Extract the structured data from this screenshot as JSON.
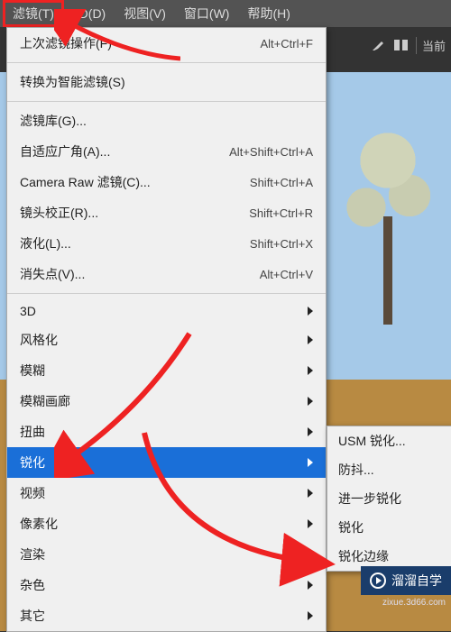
{
  "menubar": {
    "filter": "滤镜(T)",
    "threed": "3D(D)",
    "view": "视图(V)",
    "window": "窗口(W)",
    "help": "帮助(H)"
  },
  "toolbar": {
    "current": "当前"
  },
  "menu": {
    "last_filter": "上次滤镜操作(F)",
    "last_filter_sc": "Alt+Ctrl+F",
    "convert_smart": "转换为智能滤镜(S)",
    "gallery": "滤镜库(G)...",
    "adaptive": "自适应广角(A)...",
    "adaptive_sc": "Alt+Shift+Ctrl+A",
    "camera_raw": "Camera Raw 滤镜(C)...",
    "camera_raw_sc": "Shift+Ctrl+A",
    "lens": "镜头校正(R)...",
    "lens_sc": "Shift+Ctrl+R",
    "liquify": "液化(L)...",
    "liquify_sc": "Shift+Ctrl+X",
    "vanishing": "消失点(V)...",
    "vanishing_sc": "Alt+Ctrl+V",
    "threed": "3D",
    "stylize": "风格化",
    "blur": "模糊",
    "blur_gallery": "模糊画廊",
    "distort": "扭曲",
    "sharpen": "锐化",
    "video": "视频",
    "pixelate": "像素化",
    "render": "渲染",
    "noise": "杂色",
    "other": "其它"
  },
  "submenu": {
    "usm": "USM 锐化...",
    "shake": "防抖...",
    "further": "进一步锐化",
    "sharpen": "锐化",
    "edges": "锐化边缘"
  },
  "watermark": {
    "brand": "溜溜自学",
    "url": "zixue.3d66.com"
  }
}
